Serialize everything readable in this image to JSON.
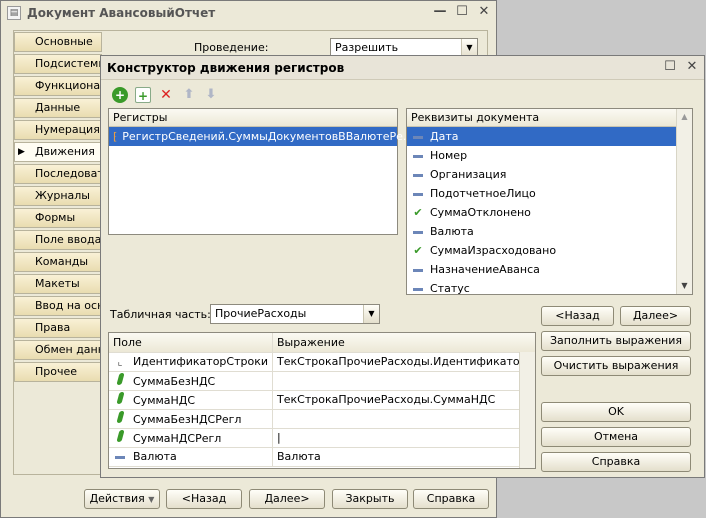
{
  "outer": {
    "title": "Документ АвансовыйОтчет",
    "tabs": [
      "Основные",
      "Подсистемы",
      "Функциональные",
      "Данные",
      "Нумерация",
      "Движения",
      "Последовательности",
      "Журналы",
      "Формы",
      "Поле ввода",
      "Команды",
      "Макеты",
      "Ввод на основании",
      "Права",
      "Обмен данными",
      "Прочее"
    ],
    "active_tab": "Движения",
    "posting_label": "Проведение:",
    "posting_value": "Разрешить",
    "buttons": {
      "actions": "Действия",
      "back": "<Назад",
      "next": "Далее>",
      "close": "Закрыть",
      "help": "Справка"
    }
  },
  "dialog": {
    "title": "Конструктор движения регистров",
    "registers_header": "Регистры",
    "registers": [
      "РегистрСведений.СуммыДокументовВВалютеРе..."
    ],
    "requisites_header": "Реквизиты документа",
    "requisites": [
      {
        "label": "Дата",
        "icon": "attribute-icon",
        "selected": true
      },
      {
        "label": "Номер",
        "icon": "attribute-icon"
      },
      {
        "label": "Организация",
        "icon": "attribute-icon"
      },
      {
        "label": "ПодотчетноеЛицо",
        "icon": "attribute-icon"
      },
      {
        "label": "СуммаОтклонено",
        "icon": "checked-attribute-icon"
      },
      {
        "label": "Валюта",
        "icon": "attribute-icon"
      },
      {
        "label": "СуммаИзрасходовано",
        "icon": "checked-attribute-icon"
      },
      {
        "label": "НазначениеАванса",
        "icon": "attribute-icon"
      },
      {
        "label": "Статус",
        "icon": "attribute-icon"
      }
    ],
    "tabular_label": "Табличная часть:",
    "tabular_value": "ПрочиеРасходы",
    "grid_headers": {
      "field": "Поле",
      "expression": "Выражение"
    },
    "grid_rows": [
      {
        "field": "ИдентификаторСтроки",
        "expression": "ТекСтрокаПрочиеРасходы.ИдентификаторСтроки",
        "icon": "dimension-icon"
      },
      {
        "field": "СуммаБезНДС",
        "expression": "",
        "icon": "resource-icon"
      },
      {
        "field": "СуммаНДС",
        "expression": "ТекСтрокаПрочиеРасходы.СуммаНДС",
        "icon": "resource-icon"
      },
      {
        "field": "СуммаБезНДСРегл",
        "expression": "",
        "icon": "resource-icon"
      },
      {
        "field": "СуммаНДСРегл",
        "expression": "",
        "icon": "resource-icon"
      },
      {
        "field": "Валюта",
        "expression": "Валюта",
        "icon": "attribute-icon"
      }
    ],
    "buttons": {
      "back": "<Назад",
      "next": "Далее>",
      "fill": "Заполнить выражения",
      "clear": "Очистить выражения",
      "ok": "OK",
      "cancel": "Отмена",
      "help": "Справка"
    },
    "colors": {
      "selection": "#316ac5",
      "accent_green": "#3a9a2a"
    }
  }
}
